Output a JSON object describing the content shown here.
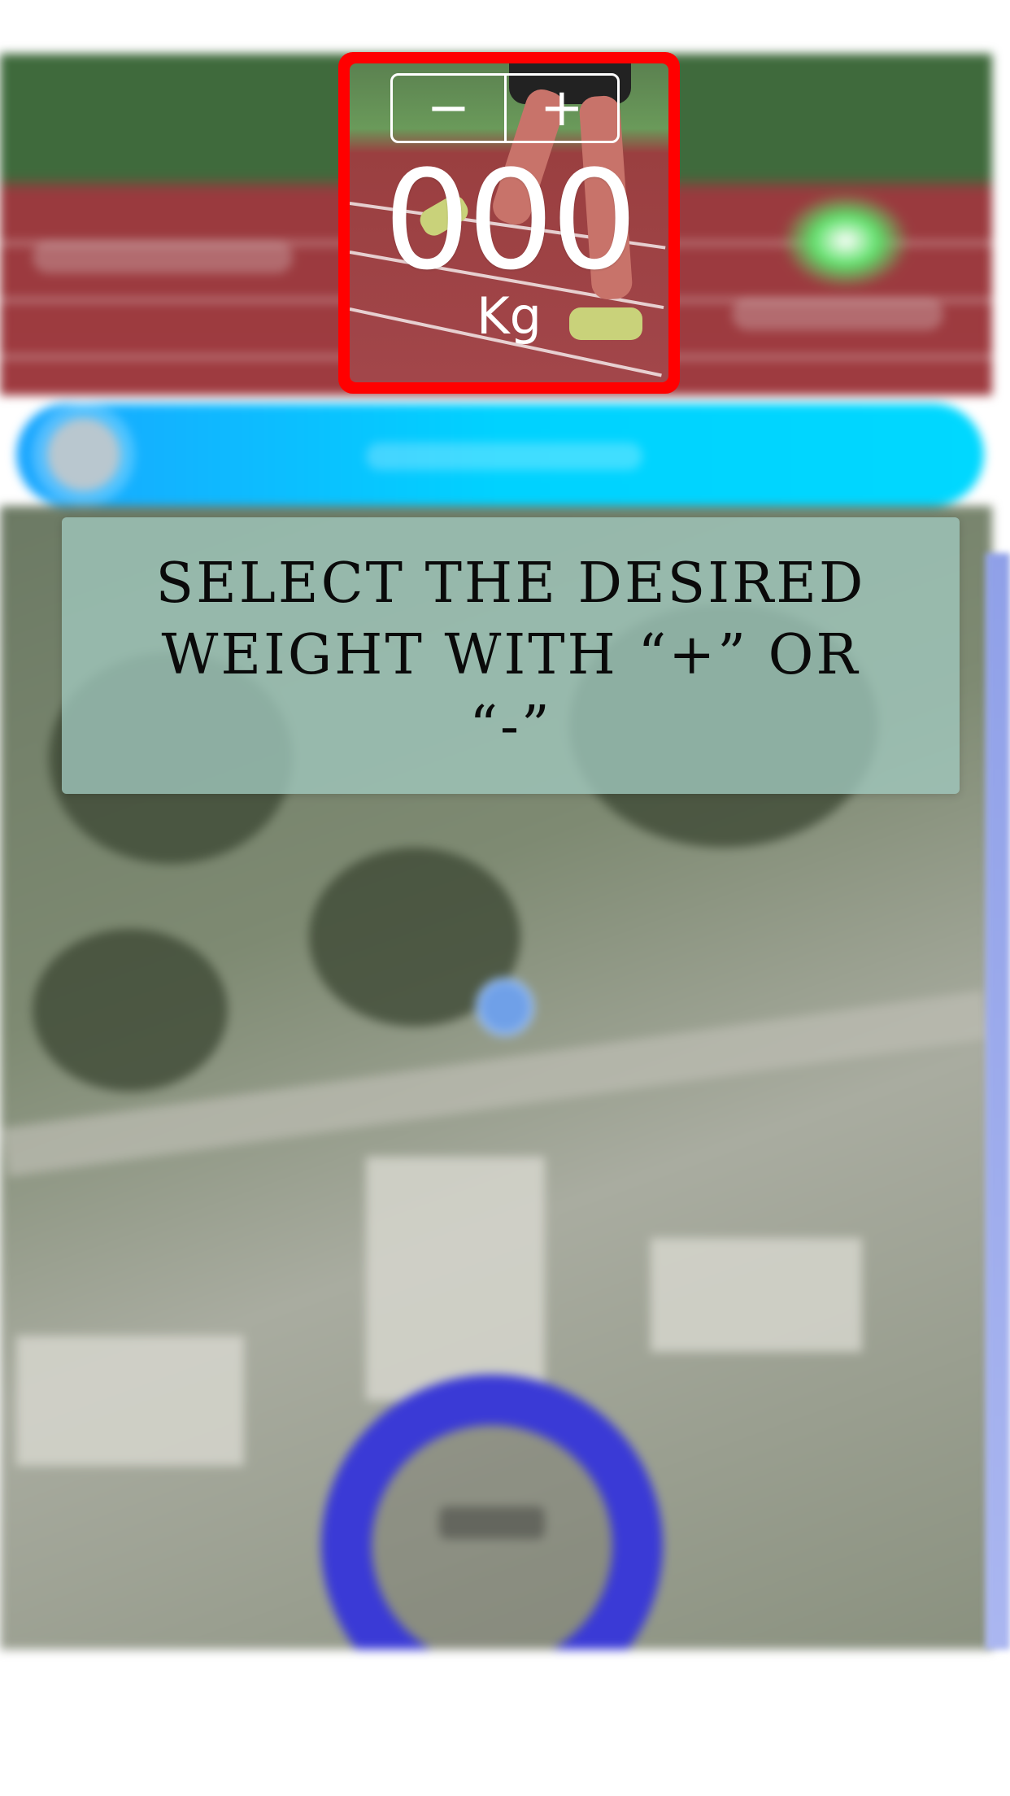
{
  "weight_widget": {
    "minus_label": "−",
    "plus_label": "+",
    "value": "000",
    "unit": "Kg",
    "highlight_color": "#ff0000"
  },
  "instruction": {
    "line1": "SELECT THE DESIRED",
    "line2": "WEIGHT WITH “+” OR “-”"
  },
  "background": {
    "accent_bar_color": "#00d2ff",
    "ring_color": "#3a3ad6"
  }
}
